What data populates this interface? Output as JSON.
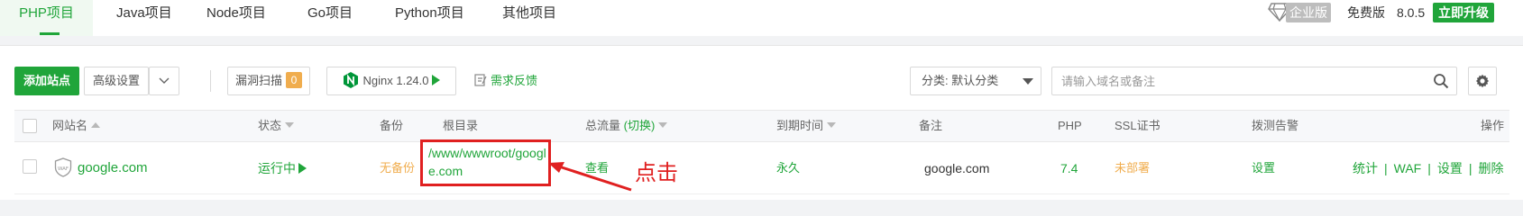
{
  "tabs": [
    {
      "label": "PHP项目",
      "active": true
    },
    {
      "label": "Java项目",
      "active": false
    },
    {
      "label": "Node项目",
      "active": false
    },
    {
      "label": "Go项目",
      "active": false
    },
    {
      "label": "Python项目",
      "active": false
    },
    {
      "label": "其他项目",
      "active": false
    }
  ],
  "header_right": {
    "enterprise_label": "企业版",
    "free_label": "免费版",
    "version": "8.0.5",
    "upgrade_label": "立即升级"
  },
  "toolbar": {
    "add_site": "添加站点",
    "advanced_settings": "高级设置",
    "vuln_scan": "漏洞扫描",
    "vuln_count": "0",
    "nginx_label": "Nginx 1.24.0",
    "feedback": "需求反馈",
    "category_select": "分类: 默认分类",
    "search_placeholder": "请输入域名或备注"
  },
  "table": {
    "headers": {
      "site_name": "网站名",
      "status": "状态",
      "backup": "备份",
      "root_dir": "根目录",
      "traffic": "总流量",
      "traffic_switch": "(切换)",
      "expire": "到期时间",
      "remark": "备注",
      "php": "PHP",
      "ssl": "SSL证书",
      "monitor": "拨测告警",
      "ops": "操作"
    },
    "rows": [
      {
        "site_name": "google.com",
        "waf_label": "WAF",
        "status": "运行中",
        "backup": "无备份",
        "root_dir": "/www/wwwroot/google.com",
        "traffic": "查看",
        "expire": "永久",
        "remark": "google.com",
        "php": "7.4",
        "ssl": "未部署",
        "monitor": "设置",
        "ops": [
          "统计",
          "WAF",
          "设置",
          "删除"
        ]
      }
    ]
  },
  "annotation": {
    "text": "点击",
    "color": "#e02020"
  },
  "colors": {
    "accent": "#20a53a",
    "warning": "#f0ad4e",
    "annotation": "#e02020"
  }
}
